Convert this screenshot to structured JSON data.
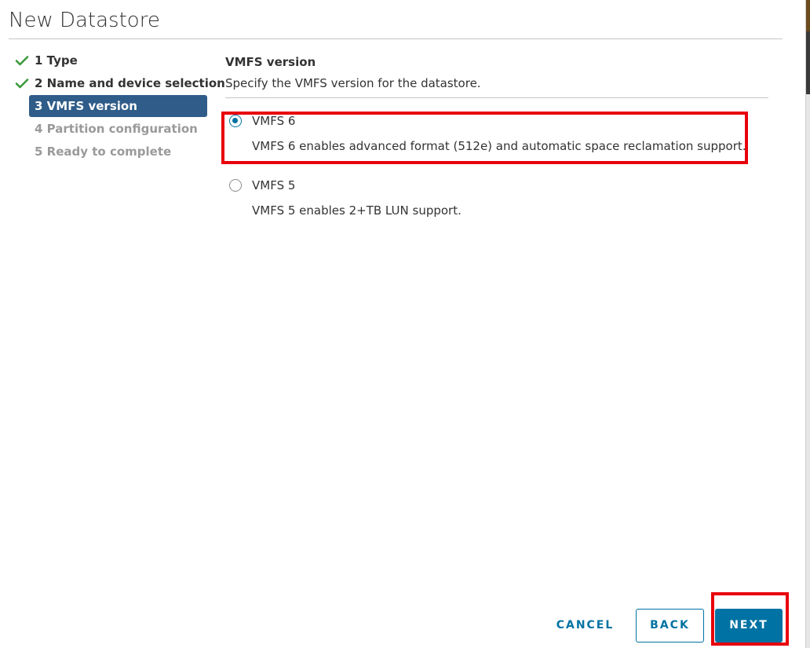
{
  "dialog": {
    "title": "New Datastore"
  },
  "wizard": {
    "steps": [
      {
        "label": "1 Type",
        "state": "done"
      },
      {
        "label": "2 Name and device selection",
        "state": "done"
      },
      {
        "label": "3 VMFS version",
        "state": "active"
      },
      {
        "label": "4 Partition configuration",
        "state": "pending"
      },
      {
        "label": "5 Ready to complete",
        "state": "pending"
      }
    ]
  },
  "main": {
    "section_title": "VMFS version",
    "section_subtitle": "Specify the VMFS version for the datastore.",
    "options": [
      {
        "label": "VMFS 6",
        "description": "VMFS 6 enables advanced format (512e) and automatic space reclamation support.",
        "selected": true
      },
      {
        "label": "VMFS 5",
        "description": "VMFS 5 enables 2+TB LUN support.",
        "selected": false
      }
    ]
  },
  "footer": {
    "cancel_label": "CANCEL",
    "back_label": "BACK",
    "next_label": "NEXT"
  },
  "colors": {
    "accent": "#0072a3",
    "active_step_bg": "#2f5c88",
    "check_green": "#3c9a3c",
    "highlight_red": "#e8000b"
  },
  "icons": {
    "done_step": "check-icon"
  }
}
